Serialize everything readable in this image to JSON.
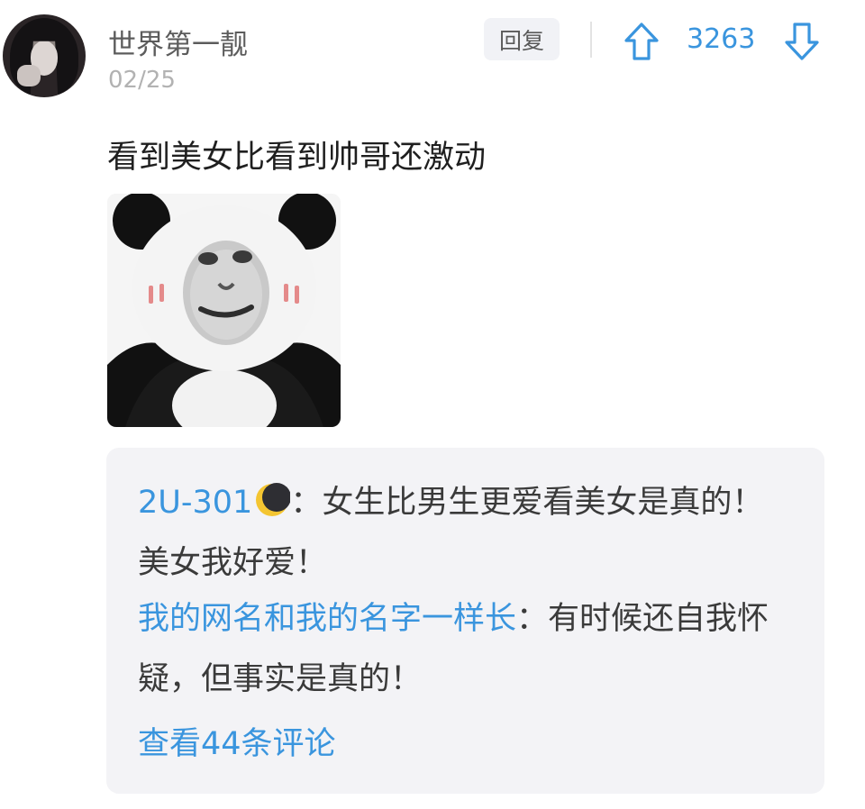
{
  "comment": {
    "username": "世界第一靓",
    "date": "02/25",
    "reply_label": "回复",
    "vote_count": "3263",
    "text": "看到美女比看到帅哥还激动"
  },
  "icons": {
    "upvote": "arrow-up-outline-icon",
    "downvote": "arrow-down-outline-icon",
    "moon": "crescent-moon-emoji"
  },
  "colors": {
    "accent": "#3a95de",
    "reply_box_bg": "#f3f3f6"
  },
  "replies": [
    {
      "name": "2U-301",
      "separator": "：",
      "text": "女生比男生更爱看美女是真的！美女我好爱！"
    },
    {
      "name": "我的网名和我的名字一样长",
      "separator": "：",
      "text": "有时候还自我怀疑，但事实是真的！"
    }
  ],
  "view_more_label": "查看44条评论"
}
